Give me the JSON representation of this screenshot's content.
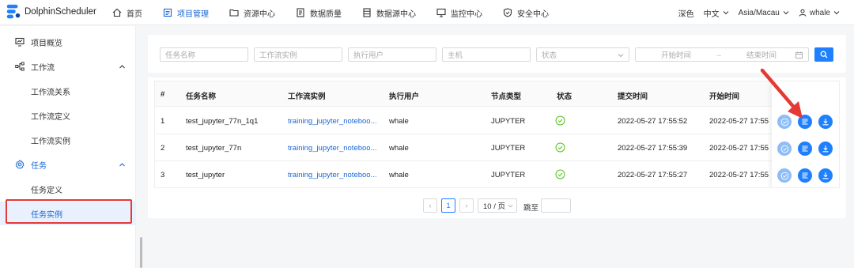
{
  "app": {
    "name": "DolphinScheduler"
  },
  "nav": {
    "items": [
      {
        "label": "首页"
      },
      {
        "label": "项目管理"
      },
      {
        "label": "资源中心"
      },
      {
        "label": "数据质量"
      },
      {
        "label": "数据源中心"
      },
      {
        "label": "监控中心"
      },
      {
        "label": "安全中心"
      }
    ],
    "theme": "深色",
    "language": "中文",
    "timezone": "Asia/Macau",
    "user": "whale"
  },
  "sidebar": {
    "project_overview": "项目概览",
    "workflow": "工作流",
    "workflow_relation": "工作流关系",
    "workflow_definition": "工作流定义",
    "workflow_instance": "工作流实例",
    "task": "任务",
    "task_definition": "任务定义",
    "task_instance": "任务实例"
  },
  "filters": {
    "task_name": "任务名称",
    "workflow_instance": "工作流实例",
    "executor": "执行用户",
    "host": "主机",
    "state": "状态",
    "start_time": "开始时间",
    "end_time": "结束时间",
    "range_arrow": "→"
  },
  "table": {
    "headers": {
      "index": "#",
      "task_name": "任务名称",
      "workflow_instance": "工作流实例",
      "executor": "执行用户",
      "node_type": "节点类型",
      "state": "状态",
      "submit_time": "提交时间",
      "start_time": "开始时间"
    },
    "rows": [
      {
        "index": "1",
        "task_name": "test_jupyter_77n_1q1",
        "workflow_instance": "training_jupyter_noteboo...",
        "executor": "whale",
        "node_type": "JUPYTER",
        "state": "success",
        "submit_time": "2022-05-27 17:55:52",
        "start_time": "2022-05-27 17:55"
      },
      {
        "index": "2",
        "task_name": "test_jupyter_77n",
        "workflow_instance": "training_jupyter_noteboo...",
        "executor": "whale",
        "node_type": "JUPYTER",
        "state": "success",
        "submit_time": "2022-05-27 17:55:39",
        "start_time": "2022-05-27 17:55"
      },
      {
        "index": "3",
        "task_name": "test_jupyter",
        "workflow_instance": "training_jupyter_noteboo...",
        "executor": "whale",
        "node_type": "JUPYTER",
        "state": "success",
        "submit_time": "2022-05-27 17:55:27",
        "start_time": "2022-05-27 17:55"
      }
    ]
  },
  "pagination": {
    "prev": "‹",
    "current_page": "1",
    "next": "›",
    "page_size": "10 / 页",
    "jump_label": "跳至"
  },
  "colors": {
    "accent": "#1e80ff",
    "success": "#52c41a",
    "highlight": "#e53935"
  }
}
